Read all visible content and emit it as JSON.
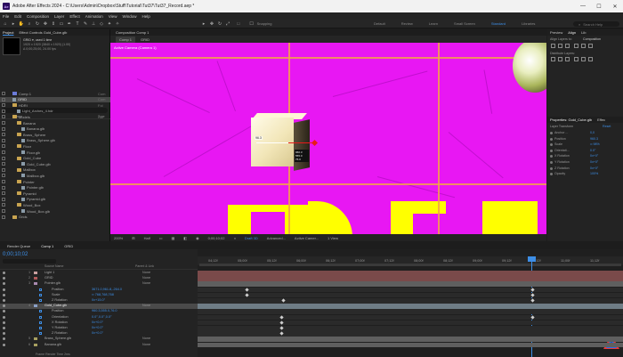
{
  "titlebar": {
    "app_icon": "Ae",
    "title": "Adobe After Effects 2024 - C:\\Users\\Admin\\Dropbox\\Stuff\\Tutorial\\Tut37\\Tut37_Record.aep *",
    "minimize": "—",
    "maximize": "☐",
    "close": "✕"
  },
  "menubar": [
    "File",
    "Edit",
    "Composition",
    "Layer",
    "Effect",
    "Animation",
    "View",
    "Window",
    "Help"
  ],
  "toolbar": {
    "snapping": "Snapping",
    "workspaces": [
      "Default",
      "Review",
      "Learn",
      "Small Screen",
      "Standard",
      "Libraries"
    ],
    "active_workspace": "Standard",
    "search_placeholder": "Search Help"
  },
  "project": {
    "tabs": [
      "Project",
      "Effect Controls Gold_Cube.glb"
    ],
    "info_name": "GRID ▾, used 1 time",
    "info_size": "1920 x 1920 (3840 x 1920) (1.00)",
    "info_dur": "Δ 0;00;25;00, 24.00 fps",
    "col_name": "Name",
    "col_type": "Type",
    "items": [
      {
        "name": "Comp 1",
        "kind": "comp",
        "indent": 0,
        "type": "Com"
      },
      {
        "name": "GRID",
        "kind": "file",
        "indent": 0,
        "type": "Com",
        "selected": true
      },
      {
        "name": "HDRI",
        "kind": "folder",
        "indent": 0,
        "type": "Fol"
      },
      {
        "name": "Light_Arches_4.hdr",
        "kind": "file",
        "indent": 1,
        "type": ""
      },
      {
        "name": "Models",
        "kind": "folder",
        "indent": 0,
        "type": "Fol"
      },
      {
        "name": "Banana",
        "kind": "folder",
        "indent": 1,
        "type": ""
      },
      {
        "name": "Banana.glb",
        "kind": "file",
        "indent": 2,
        "type": ""
      },
      {
        "name": "Brass_Sphere",
        "kind": "folder",
        "indent": 1,
        "type": ""
      },
      {
        "name": "Brass_Sphere.glb",
        "kind": "file",
        "indent": 2,
        "type": ""
      },
      {
        "name": "Floor",
        "kind": "folder",
        "indent": 1,
        "type": ""
      },
      {
        "name": "Floor.glb",
        "kind": "file",
        "indent": 2,
        "type": ""
      },
      {
        "name": "Gold_Cube",
        "kind": "folder",
        "indent": 1,
        "type": ""
      },
      {
        "name": "Gold_Cube.glb",
        "kind": "file",
        "indent": 2,
        "type": ""
      },
      {
        "name": "Mailbox",
        "kind": "folder",
        "indent": 1,
        "type": ""
      },
      {
        "name": "Mailbox.glb",
        "kind": "file",
        "indent": 2,
        "type": ""
      },
      {
        "name": "Pointer",
        "kind": "folder",
        "indent": 1,
        "type": ""
      },
      {
        "name": "Pointer.glb",
        "kind": "file",
        "indent": 2,
        "type": ""
      },
      {
        "name": "Pyramid",
        "kind": "folder",
        "indent": 1,
        "type": ""
      },
      {
        "name": "Pyramid.glb",
        "kind": "file",
        "indent": 2,
        "type": ""
      },
      {
        "name": "Wood_Box",
        "kind": "folder",
        "indent": 1,
        "type": ""
      },
      {
        "name": "Wood_Box.glb",
        "kind": "file",
        "indent": 2,
        "type": ""
      },
      {
        "name": "Grids",
        "kind": "folder",
        "indent": 0,
        "type": ""
      }
    ],
    "footer_bpc": "8 bpc"
  },
  "composition": {
    "tab": "Composition Comp 1",
    "subtabs": [
      "Comp 1",
      "GRID"
    ],
    "active_camera": "Active Camera (Camera 1)",
    "cube_label": "96.3",
    "gizmo_info": [
      "960.3",
      "555.0",
      "76.0"
    ],
    "footer": {
      "zoom": "200%",
      "resolution": "Half",
      "timecode": "0;00;10;02",
      "renderer": "Draft 3D",
      "advanced": "Advanced...",
      "camera": "Active Camer...",
      "view": "1 View"
    }
  },
  "right_panel": {
    "tabs_top": [
      "Preview",
      "Align",
      "Lib"
    ],
    "align_layers_to": "Align Layers to:",
    "align_to_value": "Composition",
    "distribute": "Distribute Layers:",
    "props_tabs": [
      "Properties: Gold_Cube.glb",
      "Effec"
    ],
    "layer_transform": "Layer Transform",
    "reset": "Reset",
    "props": [
      {
        "k": "Anchor ...",
        "v": "0,0"
      },
      {
        "k": "Position",
        "v": "960.3"
      },
      {
        "k": "Scale",
        "v": "∞ 98%"
      },
      {
        "k": "Orientati...",
        "v": "0.0°"
      },
      {
        "k": "X Rotation",
        "v": "0x+0°"
      },
      {
        "k": "Y Rotation",
        "v": "0x+0°"
      },
      {
        "k": "Z Rotation",
        "v": "0x+0°"
      },
      {
        "k": "Opacity",
        "v": "100%"
      }
    ]
  },
  "timeline": {
    "tabs": [
      "Render Queue",
      "Comp 1",
      "GRID"
    ],
    "current_time": "0;00;10;02",
    "col_name": "Source Name",
    "col_parent": "Parent & Link",
    "ruler": [
      "04;12f",
      "05;00f",
      "05;12f",
      "06;00f",
      "06;12f",
      "07;00f",
      "07;12f",
      "08;00f",
      "08;12f",
      "09;00f",
      "09;12f",
      "10;12f",
      "11;00f",
      "11;12f"
    ],
    "layers": [
      {
        "num": "1",
        "name": "Light 1",
        "val": "",
        "parent": "None"
      },
      {
        "num": "2",
        "name": "GRID",
        "val": "",
        "parent": "None"
      },
      {
        "num": "3",
        "name": "Pointer.glb",
        "val": "",
        "parent": "None"
      },
      {
        "num": "",
        "name": "Position",
        "val": "3671.0,961.8,-264.0",
        "parent": ""
      },
      {
        "num": "",
        "name": "Scale",
        "val": "∞ 768,768,768",
        "parent": ""
      },
      {
        "num": "",
        "name": "Z Rotation",
        "val": "0x+15.0°",
        "parent": ""
      },
      {
        "num": "4",
        "name": "Gold_Cube.glb",
        "val": "",
        "parent": "None",
        "selected": true
      },
      {
        "num": "",
        "name": "Position",
        "val": "960.3,555.0,76.0",
        "parent": ""
      },
      {
        "num": "",
        "name": "Orientation",
        "val": "0.0°,0.0°,0.0°",
        "parent": ""
      },
      {
        "num": "",
        "name": "X Rotation",
        "val": "0x+0.0°",
        "parent": ""
      },
      {
        "num": "",
        "name": "Y Rotation",
        "val": "0x+0.0°",
        "parent": ""
      },
      {
        "num": "",
        "name": "Z Rotation",
        "val": "0x+0.0°",
        "parent": ""
      },
      {
        "num": "5",
        "name": "Brass_Sphere.glb",
        "val": "",
        "parent": "None"
      },
      {
        "num": "6",
        "name": "Banana.glb",
        "val": "",
        "parent": "None"
      }
    ],
    "footer": "Frame Render Time 2ms"
  }
}
